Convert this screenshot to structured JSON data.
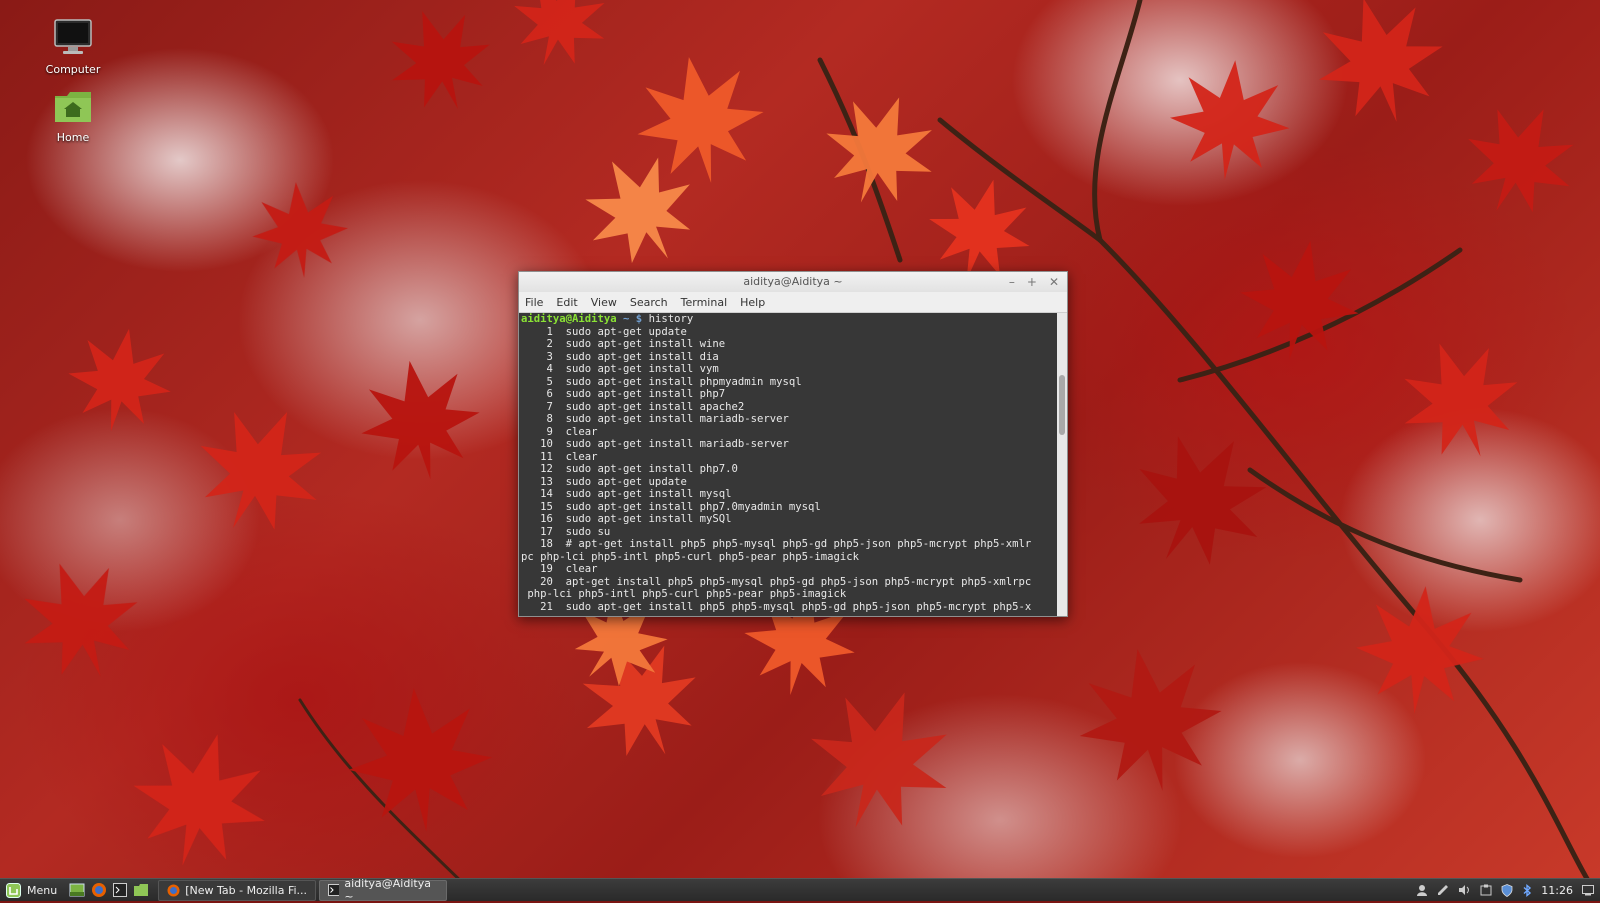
{
  "desktop": {
    "icons": [
      {
        "label": "Computer"
      },
      {
        "label": "Home"
      }
    ]
  },
  "terminal": {
    "title": "aiditya@Aiditya ~",
    "menu": [
      "File",
      "Edit",
      "View",
      "Search",
      "Terminal",
      "Help"
    ],
    "prompt_user": "aiditya@Aiditya",
    "prompt_path": " ~ $",
    "command": " history",
    "lines": [
      "    1  sudo apt-get update",
      "    2  sudo apt-get install wine",
      "    3  sudo apt-get install dia",
      "    4  sudo apt-get install vym",
      "    5  sudo apt-get install phpmyadmin mysql",
      "    6  sudo apt-get install php7",
      "    7  sudo apt-get install apache2",
      "    8  sudo apt-get install mariadb-server",
      "    9  clear",
      "   10  sudo apt-get install mariadb-server",
      "   11  clear",
      "   12  sudo apt-get install php7.0",
      "   13  sudo apt-get update",
      "   14  sudo apt-get install mysql",
      "   15  sudo apt-get install php7.0myadmin mysql",
      "   16  sudo apt-get install mySQl",
      "   17  sudo su",
      "   18  # apt-get install php5 php5-mysql php5-gd php5-json php5-mcrypt php5-xmlr",
      "pc php-lci php5-intl php5-curl php5-pear php5-imagick",
      "   19  clear",
      "   20  apt-get install php5 php5-mysql php5-gd php5-json php5-mcrypt php5-xmlrpc",
      " php-lci php5-intl php5-curl php5-pear php5-imagick",
      "   21  sudo apt-get install php5 php5-mysql php5-gd php5-json php5-mcrypt php5-x"
    ]
  },
  "taskbar": {
    "menu_label": "Menu",
    "windows": [
      {
        "label": "[New Tab - Mozilla Fi...",
        "active": false
      },
      {
        "label": "aiditya@Aiditya ~",
        "active": true
      }
    ],
    "clock": "11:26"
  },
  "colors": {
    "prompt_user": "#8ae234",
    "prompt_path": "#729fcf",
    "terminal_bg": "#373737",
    "taskbar_bg": "#2a2a2a"
  }
}
